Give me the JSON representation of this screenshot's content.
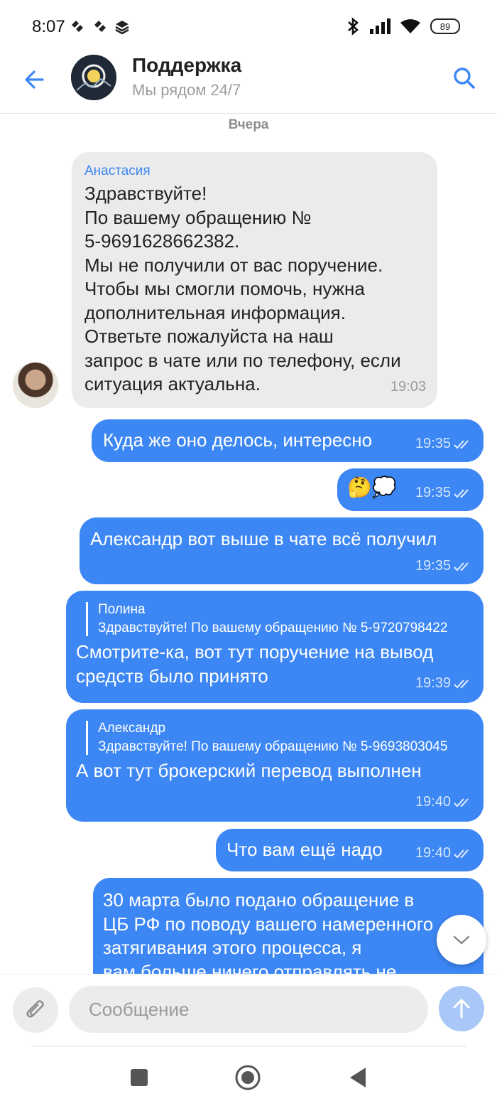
{
  "status_bar": {
    "time": "8:07",
    "battery": "89"
  },
  "header": {
    "title": "Поддержка",
    "subtitle": "Мы рядом 24/7"
  },
  "day_label": "Вчера",
  "messages": [
    {
      "sender": "Анастасия",
      "text": "Здравствуйте!\nПо вашему обращению №\n5-9691628662382.\nМы не получили от вас поручение.\nЧтобы мы смогли помочь, нужна\nдополнительная информация.\nОтветьте пожалуйста на наш\nзапрос в чате или по телефону, если\nситуация актуальна.",
      "time": "19:03"
    },
    {
      "text": "Куда же оно делось, интересно",
      "time": "19:35"
    },
    {
      "text": "🤔💭",
      "time": "19:35"
    },
    {
      "text": "Александр вот выше в чате всё получил",
      "time": "19:35"
    },
    {
      "quote_name": "Полина",
      "quote_text": "Здравствуйте! По вашему обращению № 5-9720798422",
      "text": "Смотрите-ка, вот тут поручение на вывод\nсредств было принято",
      "time": "19:39"
    },
    {
      "quote_name": "Александр",
      "quote_text": "Здравствуйте! По вашему обращению № 5-9693803045",
      "text": "А вот тут брокерский перевод выполнен",
      "time": "19:40"
    },
    {
      "text": "Что вам ещё надо",
      "time": "19:40"
    },
    {
      "text": "30 марта было подано обращение в\nЦБ РФ по поводу вашего намеренного\nзатягивания этого процесса, я\nвам больше ничего отправлять не"
    }
  ],
  "input": {
    "placeholder": "Сообщение"
  },
  "icons": {
    "back": "arrow-left-icon",
    "search": "search-icon",
    "attach": "paperclip-icon",
    "send": "arrow-up-icon",
    "scroll_down": "chevron-down-icon",
    "read": "double-check-icon"
  },
  "colors": {
    "accent": "#3d87f5",
    "incoming": "#ebebeb",
    "send_disabled": "#a9c8f7"
  }
}
